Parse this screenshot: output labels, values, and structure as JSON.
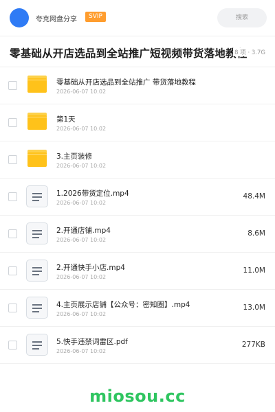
{
  "header": {
    "user_name": "夸克网盘分享",
    "badge": "SVIP",
    "search_placeholder": "搜索"
  },
  "title_bar": {
    "title": "零基础从开店选品到全站推广短视频带货落地教程",
    "summary": "8 项 · 3.7G"
  },
  "files": [
    {
      "type": "folder",
      "name": "零基础从开店选品到全站推广 带货落地教程",
      "date": "2026-06-07 10:02",
      "size": ""
    },
    {
      "type": "folder",
      "name": "第1天",
      "date": "2026-06-07 10:02",
      "size": ""
    },
    {
      "type": "folder",
      "name": "3.主页装修",
      "date": "2026-06-07 10:02",
      "size": ""
    },
    {
      "type": "file",
      "name": "1.2026带货定位.mp4",
      "date": "2026-06-07 10:02",
      "size": "48.4M"
    },
    {
      "type": "file",
      "name": "2.开通店铺.mp4",
      "date": "2026-06-07 10:02",
      "size": "8.6M"
    },
    {
      "type": "file",
      "name": "2.开通快手小店.mp4",
      "date": "2026-06-07 10:02",
      "size": "11.0M"
    },
    {
      "type": "file",
      "name": "4.主页展示店铺【公众号：密知圈】.mp4",
      "date": "2026-06-07 10:02",
      "size": "13.0M"
    },
    {
      "type": "file",
      "name": "5.快手违禁词雷区.pdf",
      "date": "2026-06-07 10:02",
      "size": "277KB"
    }
  ],
  "watermark": "miosou.cc",
  "colors": {
    "avatar": "#2f7bf5",
    "svip_badge": "#ff9d2e",
    "folder": "#ffc21a",
    "watermark": "#2fc560"
  }
}
